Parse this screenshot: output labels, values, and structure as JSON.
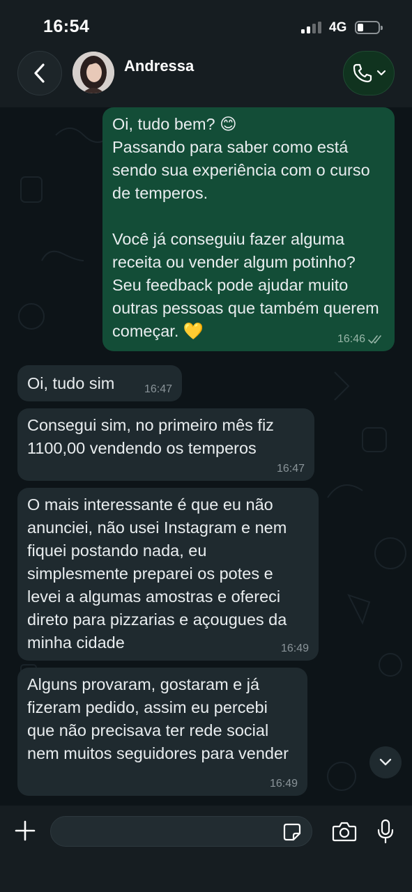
{
  "status_bar": {
    "time": "16:54",
    "network": "4G",
    "battery_level": 0.25
  },
  "header": {
    "contact_name": "Andressa",
    "back_icon": "chevron-left-icon",
    "call_icon": "phone-icon"
  },
  "messages": [
    {
      "direction": "outgoing",
      "text": "Oi, tudo bem? 😊\nPassando para saber como está sendo sua experiência com o curso de temperos.\n\nVocê já conseguiu fazer alguma receita ou vender algum potinho? Seu feedback pode ajudar muito outras pessoas que também querem começar. 💛",
      "time": "16:46",
      "status": "read"
    },
    {
      "direction": "incoming",
      "text": "Oi, tudo sim",
      "time": "16:47"
    },
    {
      "direction": "incoming",
      "text": "Consegui sim, no primeiro mês fiz 1100,00 vendendo os temperos",
      "time": "16:47"
    },
    {
      "direction": "incoming",
      "text": "O mais interessante é que eu não anunciei, não usei Instagram e nem fiquei postando nada, eu simplesmente preparei os potes e levei a algumas amostras e ofereci direto para pizzarias e açougues da minha cidade",
      "time": "16:49"
    },
    {
      "direction": "incoming",
      "text": "Alguns provaram, gostaram e já fizeram pedido, assim eu percebi que não precisava ter rede social nem muitos seguidores para vender",
      "time": "16:49"
    }
  ],
  "composer": {
    "input_value": "",
    "input_placeholder": "",
    "icons": [
      "plus-icon",
      "sticker-icon",
      "camera-icon",
      "microphone-icon"
    ]
  },
  "colors": {
    "outgoing_bubble": "#134d37",
    "incoming_bubble": "#1f2a2f",
    "background": "#0d1418",
    "bar": "#161d21"
  }
}
